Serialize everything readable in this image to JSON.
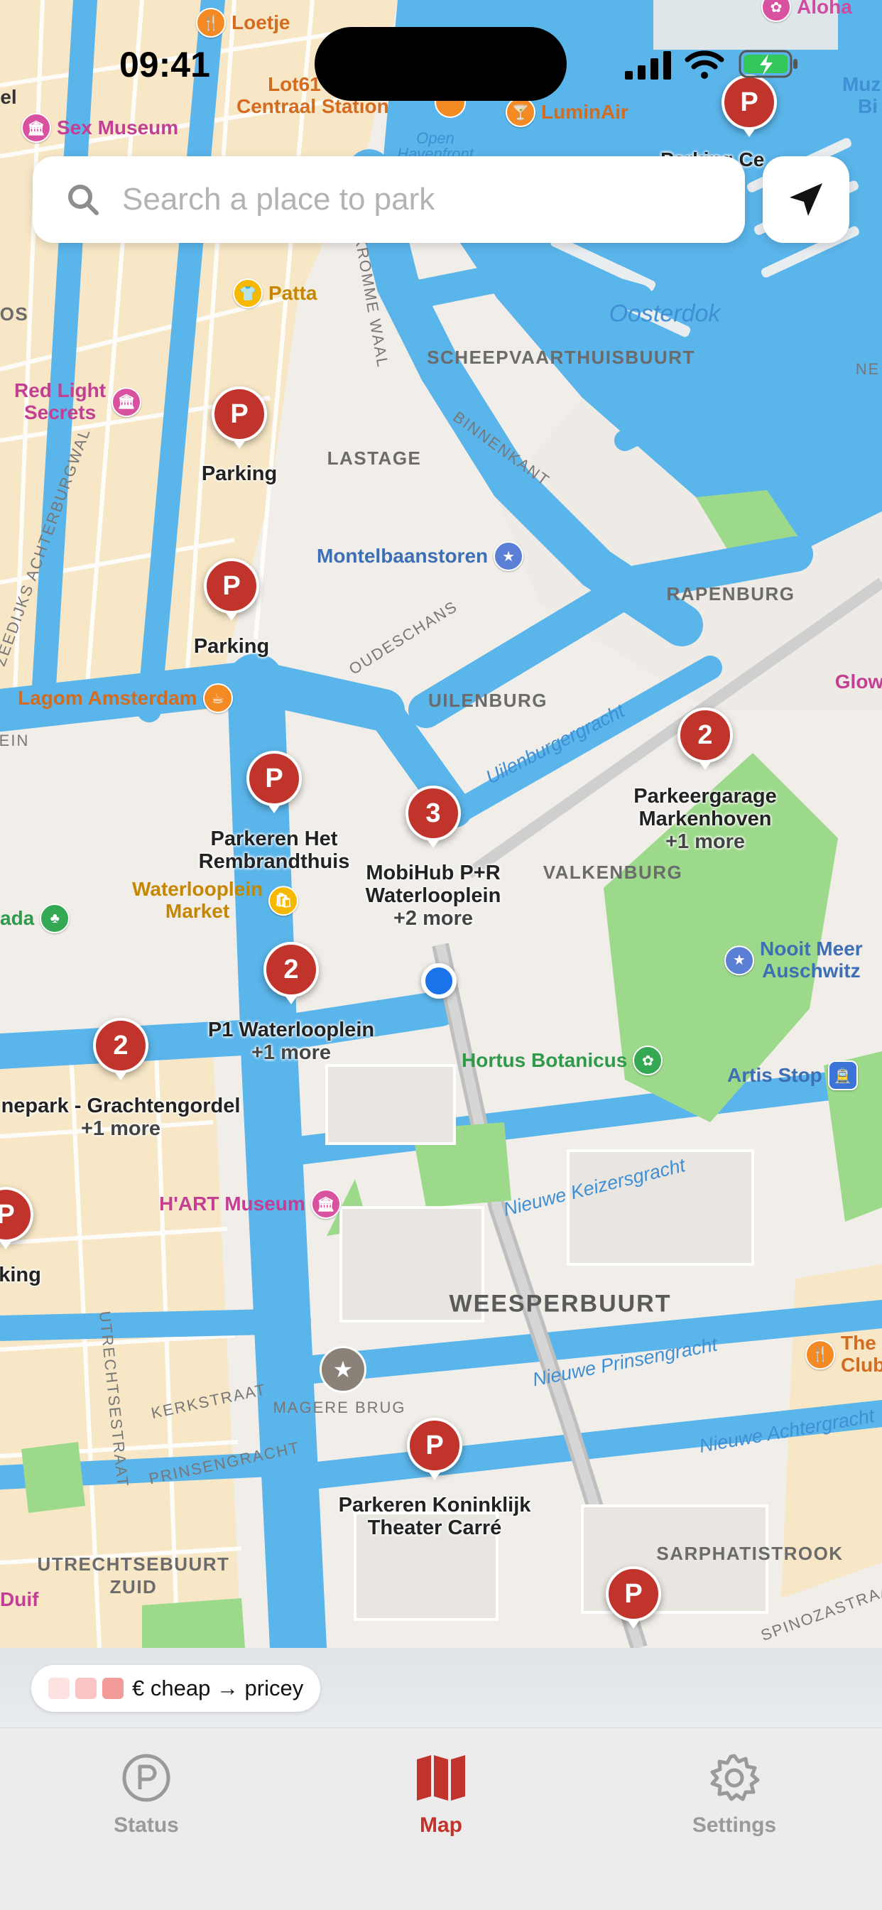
{
  "status_bar": {
    "time": "09:41"
  },
  "search": {
    "placeholder": "Search a place to park"
  },
  "map": {
    "districts": {
      "scheepvaart": "SCHEEPVAARTHUISBUURT",
      "lastage": "LASTAGE",
      "rapenburg": "RAPENBURG",
      "uilenburg": "UILENBURG",
      "valkenburg": "VALKENBURG",
      "weesperbuurt": "WEESPERBUURT",
      "sarphatistrook": "SARPHATISTROOK",
      "utrechtsebuurt_1": "UTRECHTSEBUURT",
      "utrechtsebuurt_2": "ZUID"
    },
    "waters": {
      "oosterdok": "Oosterdok",
      "open_havenfront_1": "Open",
      "open_havenfront_2": "Havenfront",
      "uilenburgergracht": "Uilenburgergracht",
      "nieuwe_keizersgracht": "Nieuwe Keizersgracht",
      "nieuwe_prinsengracht": "Nieuwe Prinsengracht",
      "nieuwe_achtergracht": "Nieuwe Achtergracht"
    },
    "streets": {
      "kromme_waal": "KROMME WAAL",
      "binnenkant": "BINNENKANT",
      "oudeschans": "OUDESCHANS",
      "achterburgwal": "ZEEDIJKS ACHTERBURGWAL",
      "utrechtsestraat": "UTRECHTSESTRAAT",
      "kerkstraat": "KERKSTRAAT",
      "prinsengracht": "PRINSENGRACHT",
      "spinozastraat": "SPINOZASTRAAT",
      "magere_brug": "MAGERE BRUG",
      "ne": "NE",
      "os": "OS",
      "ein": "EIN"
    },
    "pois": {
      "loetje": "Loetje",
      "aloha": "Aloha",
      "lot61_1": "Lot61 Am",
      "lot61_2": "Centraal Station",
      "luminair": "LuminAir",
      "sex_museum": "Sex Museum",
      "el": "el",
      "muz_1": "Muz",
      "muz_2": "Bi",
      "patta": "Patta",
      "red_light_1": "Red Light",
      "red_light_2": "Secrets",
      "montelbaanstoren": "Montelbaanstoren",
      "lagom": "Lagom Amsterdam",
      "glow": "Glow",
      "waterlooplein_market_1": "Waterlooplein",
      "waterlooplein_market_2": "Market",
      "ada": "ada",
      "nooit_meer_1": "Nooit Meer",
      "nooit_meer_2": "Auschwitz",
      "hortus": "Hortus Botanicus",
      "artis_stop": "Artis Stop",
      "hart_museum": "H'ART Museum",
      "the_club_1": "The",
      "the_club_2": "Club",
      "duif": "Duif"
    },
    "parking": [
      {
        "id": "top-right",
        "glyph": "P",
        "label": "",
        "more": ""
      },
      {
        "id": "parking-1",
        "glyph": "P",
        "label": "Parking",
        "more": ""
      },
      {
        "id": "parking-2",
        "glyph": "P",
        "label": "Parking",
        "more": ""
      },
      {
        "id": "markenhoven",
        "glyph": "2",
        "label": "Parkeergarage\nMarkenhoven",
        "more": "+1 more"
      },
      {
        "id": "rembrandthuis",
        "glyph": "P",
        "label": "Parkeren Het\nRembrandthuis",
        "more": ""
      },
      {
        "id": "mobihub",
        "glyph": "3",
        "label": "MobiHub P+R\nWaterlooplein",
        "more": "+2 more"
      },
      {
        "id": "p1-waterlooplein",
        "glyph": "2",
        "label": "P1 Waterlooplein",
        "more": "+1 more"
      },
      {
        "id": "grachtengordel",
        "glyph": "2",
        "label": "nepark - Grachtengordel",
        "more": "+1 more"
      },
      {
        "id": "left-edge",
        "glyph": "P",
        "label": "king",
        "more": ""
      },
      {
        "id": "carre",
        "glyph": "P",
        "label": "Parkeren Koninklijk\nTheater Carré",
        "more": ""
      },
      {
        "id": "bottom",
        "glyph": "P",
        "label": "",
        "more": ""
      },
      {
        "id": "top-cut",
        "glyph": "",
        "label": "Parking Ce\nen",
        "more": ""
      }
    ]
  },
  "legend": {
    "label": "€ cheap → pricey",
    "swatches": [
      "#fde2e2",
      "#f9c4c3",
      "#f29b98"
    ]
  },
  "tabs": [
    {
      "label": "Status",
      "icon": "parking-circle-icon",
      "active": false
    },
    {
      "label": "Map",
      "icon": "map-icon",
      "active": true
    },
    {
      "label": "Settings",
      "icon": "gear-icon",
      "active": false
    }
  ],
  "colors": {
    "accent": "#c1342c",
    "water": "#5ab5ea",
    "park": "#9cd98a",
    "user_location": "#1a73e8",
    "tab_inactive": "#9a9a9a"
  }
}
